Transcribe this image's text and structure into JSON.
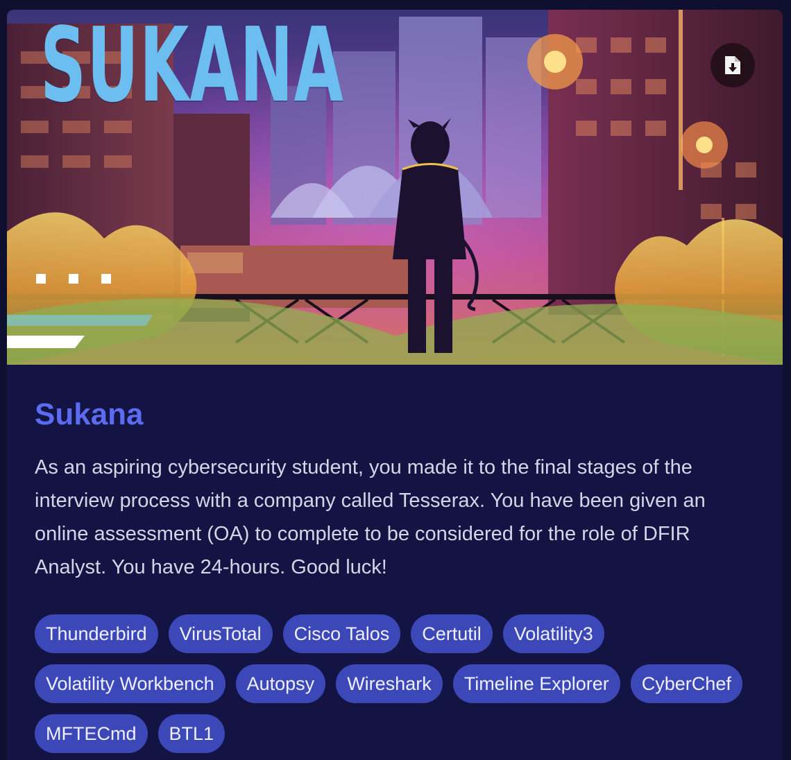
{
  "banner": {
    "title": "SUKANA",
    "download_icon": "file-download-icon"
  },
  "room": {
    "title": "Sukana",
    "description": "As an aspiring cybersecurity student, you made it to the final stages of the interview process with a company called Tesserax. You have been given an online assessment (OA) to complete to be considered for the role of DFIR Analyst. You have 24-hours. Good luck!"
  },
  "tags": [
    "Thunderbird",
    "VirusTotal",
    "Cisco Talos",
    "Certutil",
    "Volatility3",
    "Volatility Workbench",
    "Autopsy",
    "Wireshark",
    "Timeline Explorer",
    "CyberChef",
    "MFTECmd",
    "BTL1"
  ],
  "colors": {
    "accent": "#5b6cf0",
    "tag_bg": "#3d48b8",
    "card_bg": "#131443",
    "banner_title": "#6cbef0"
  }
}
